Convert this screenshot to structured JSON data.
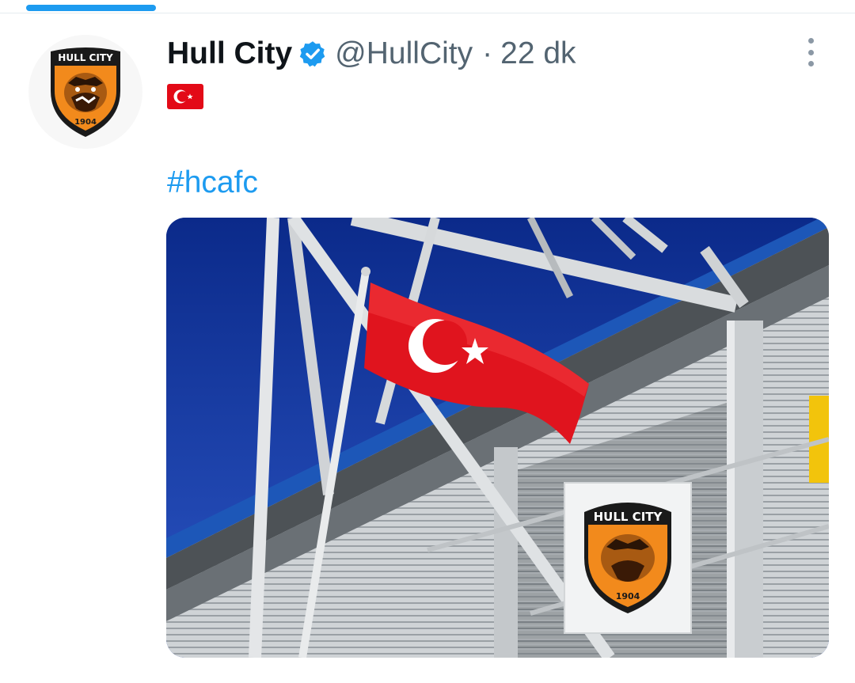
{
  "tweet": {
    "display_name": "Hull City",
    "handle": "@HullCity",
    "separator": "·",
    "time_ago": "22 dk",
    "hashtag": "#hcafc",
    "flag_emoji": "flag-turkey-icon"
  },
  "avatar": {
    "crest_text": "HULL CITY",
    "crest_year": "1904"
  },
  "media": {
    "sign_text": "HULL CITY",
    "sign_year": "1904"
  },
  "colors": {
    "accent": "#1d9bf0",
    "name_text": "#0f1419",
    "secondary_text": "#536471",
    "flag_red": "#e30a17",
    "crest_orange": "#f28a1c"
  }
}
